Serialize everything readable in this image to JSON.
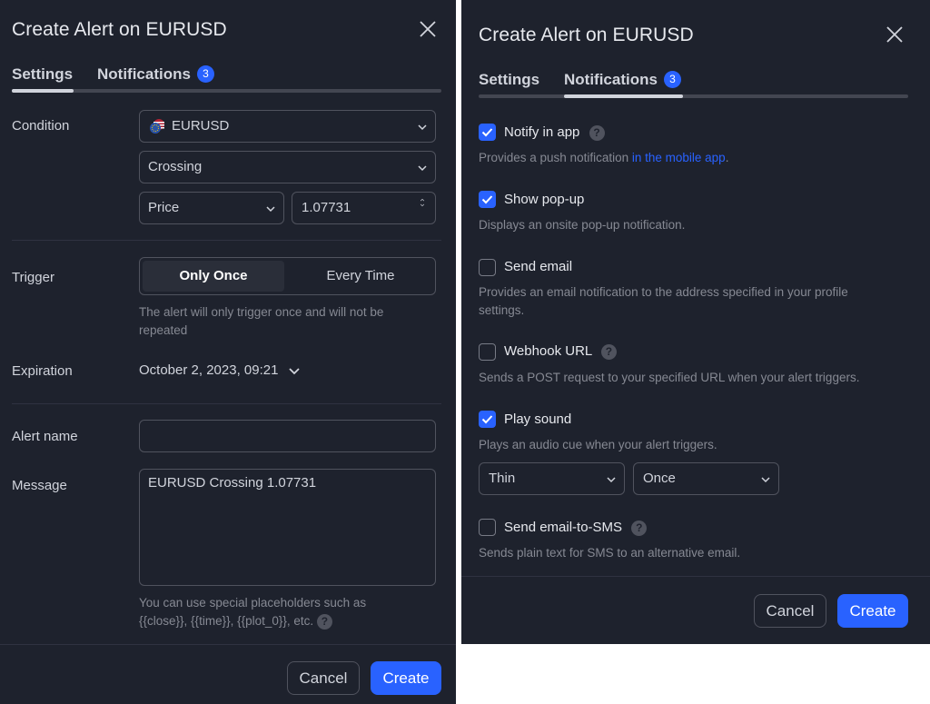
{
  "left": {
    "title": "Create Alert on EURUSD",
    "tabs": [
      {
        "label": "Settings"
      },
      {
        "label": "Notifications",
        "badge": "3"
      }
    ],
    "condition": {
      "label": "Condition",
      "symbol": "EURUSD",
      "operator": "Crossing",
      "source": "Price",
      "value": "1.07731"
    },
    "trigger": {
      "label": "Trigger",
      "options": [
        "Only Once",
        "Every Time"
      ],
      "selected": "Only Once",
      "hint": "The alert will only trigger once and will not be repeated"
    },
    "expiration": {
      "label": "Expiration",
      "value": "October 2, 2023, 09:21"
    },
    "alert_name": {
      "label": "Alert name",
      "value": ""
    },
    "message": {
      "label": "Message",
      "value": "EURUSD Crossing 1.07731",
      "hint_line1": "You can use special placeholders such as",
      "hint_line2": "{{close}}, {{time}}, {{plot_0}}, etc."
    },
    "buttons": {
      "cancel": "Cancel",
      "create": "Create"
    }
  },
  "right": {
    "title": "Create Alert on EURUSD",
    "tabs": [
      {
        "label": "Settings"
      },
      {
        "label": "Notifications",
        "badge": "3"
      }
    ],
    "options": [
      {
        "label": "Notify in app",
        "checked": true,
        "help": true,
        "desc_pre": "Provides a push notification ",
        "desc_link": "in the mobile app",
        "desc_post": "."
      },
      {
        "label": "Show pop-up",
        "checked": true,
        "desc": "Displays an onsite pop-up notification."
      },
      {
        "label": "Send email",
        "checked": false,
        "desc_line1": "Provides an email notification to the address specified in your profile",
        "desc_line2": "settings."
      },
      {
        "label": "Webhook URL",
        "checked": false,
        "help": true,
        "desc": "Sends a POST request to your specified URL when your alert triggers."
      },
      {
        "label": "Play sound",
        "checked": true,
        "desc": "Plays an audio cue when your alert triggers."
      },
      {
        "label": "Send email-to-SMS",
        "checked": false,
        "help": true,
        "desc": "Sends plain text for SMS to an alternative email."
      }
    ],
    "sound": {
      "name": "Thin",
      "repeat": "Once"
    },
    "buttons": {
      "cancel": "Cancel",
      "create": "Create"
    }
  },
  "help_glyph": "?",
  "colors": {
    "accent": "#2962ff",
    "panel_bg": "#1e222d",
    "text": "#d1d4dc",
    "muted": "#868993"
  },
  "icons": [
    "close-icon",
    "chevron-down-icon",
    "eurusd-flag-icon",
    "help-icon",
    "checkmark-icon",
    "stepper-icon"
  ]
}
